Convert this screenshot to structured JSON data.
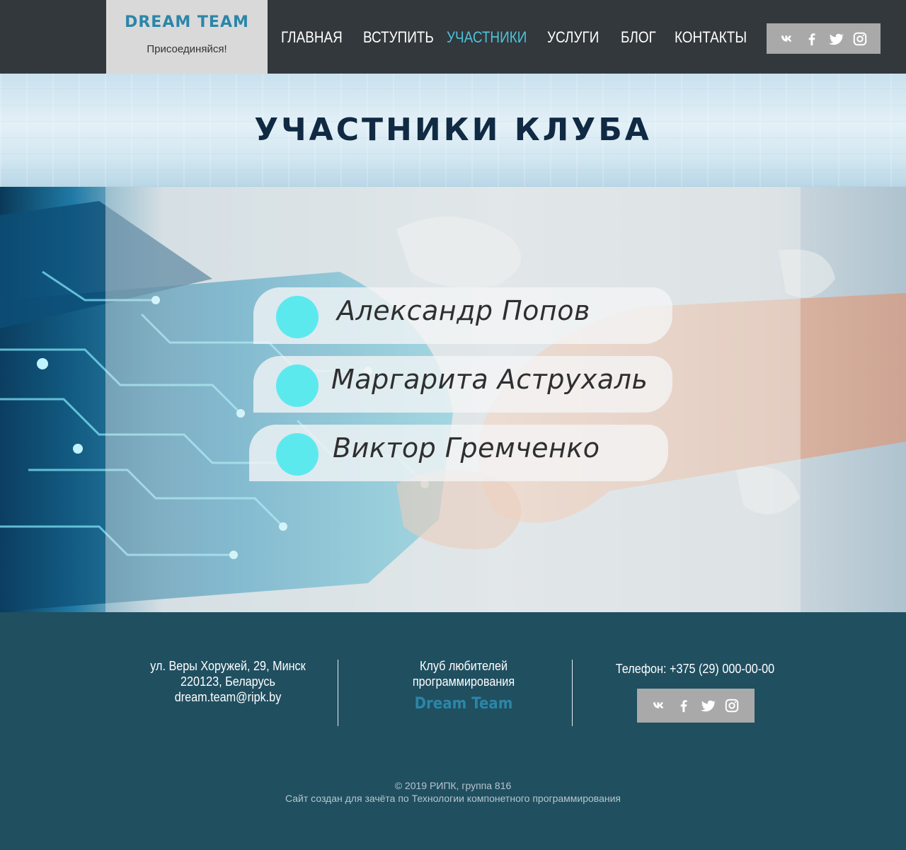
{
  "header": {
    "logo_title": "DREAM TEAM",
    "logo_subtitle": "Присоединяйся!",
    "nav": [
      {
        "label": "ГЛАВНАЯ",
        "active": false
      },
      {
        "label": "ВСТУПИТЬ",
        "active": false
      },
      {
        "label": "УЧАСТНИКИ",
        "active": true
      },
      {
        "label": "УСЛУГИ",
        "active": false
      },
      {
        "label": "БЛОГ",
        "active": false
      },
      {
        "label": "КОНТАКТЫ",
        "active": false
      }
    ],
    "social": [
      "vk-icon",
      "facebook-icon",
      "twitter-icon",
      "instagram-icon"
    ]
  },
  "banner": {
    "title": "УЧАСТНИКИ КЛУБА"
  },
  "members": [
    {
      "name": "Александр Попов"
    },
    {
      "name": "Маргарита Аструхаль"
    },
    {
      "name": "Виктор Гремченко"
    }
  ],
  "footer": {
    "address_line1": "ул. Веры Хоружей, 29, Минск",
    "address_line2": "220123, Беларусь",
    "email": "dream.team@ripk.by",
    "club_line1": "Клуб любителей",
    "club_line2": "программирования",
    "brand": "Dream Team",
    "phone": "Телефон: +375 (29) 000-00-00",
    "copyright_line1": "© 2019 РИПК, группа 816",
    "copyright_line2": "Сайт создан для зачёта по Технологии компонетного программирования"
  },
  "colors": {
    "header_bg": "#32383c",
    "logo_bg": "#d9d9d9",
    "accent": "#4fc1d8",
    "brand_blue": "#2b86a8",
    "social_bg": "#a9a9a9",
    "member_dot": "#5ce9ee",
    "footer_bg": "#204f60"
  }
}
